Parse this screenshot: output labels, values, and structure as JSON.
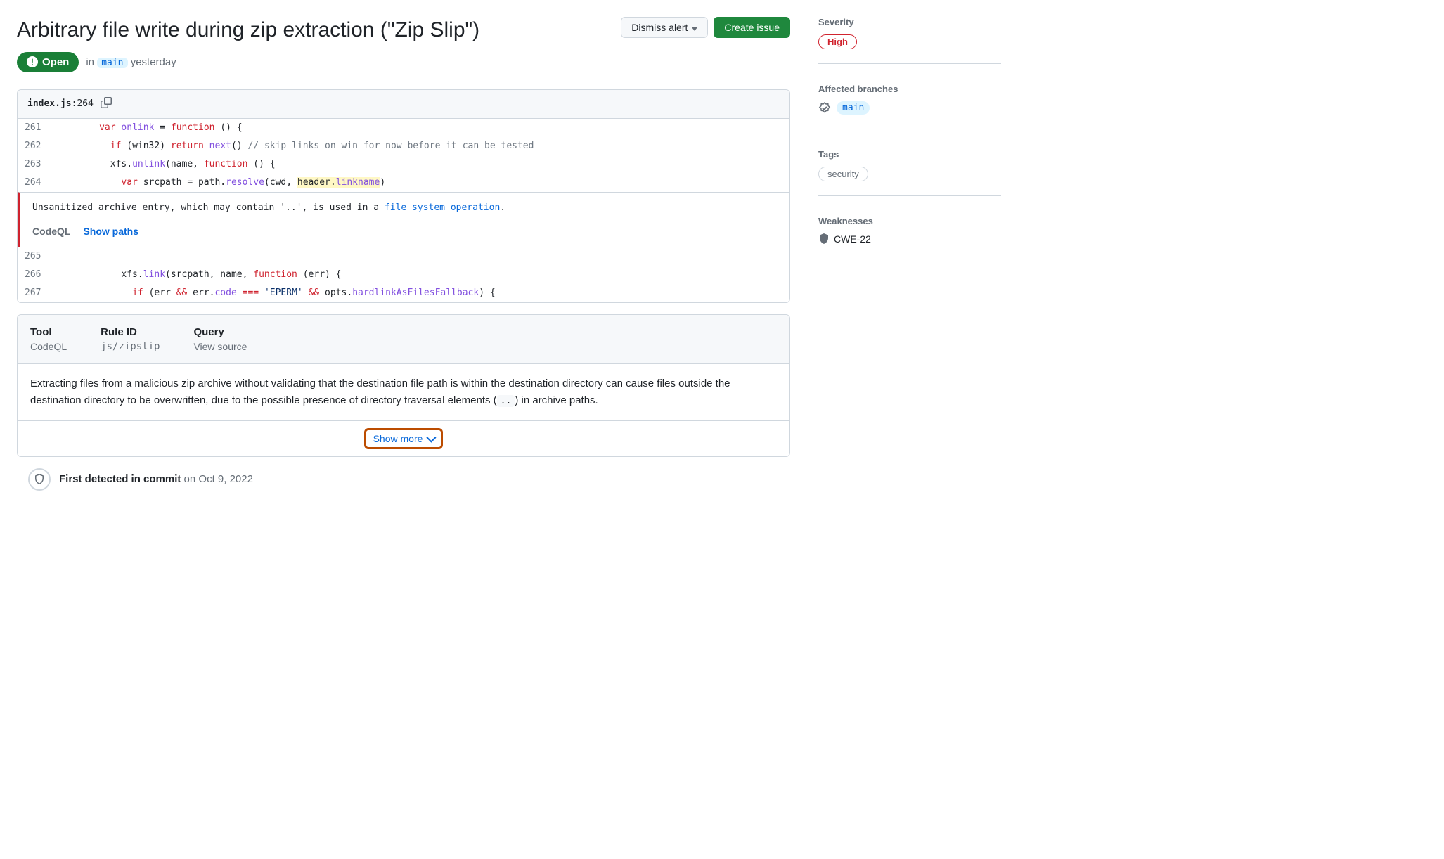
{
  "title": "Arbitrary file write during zip extraction (\"Zip Slip\")",
  "actions": {
    "dismiss": "Dismiss alert",
    "create_issue": "Create issue"
  },
  "status": {
    "state": "Open",
    "in_text": "in",
    "branch": "main",
    "time": "yesterday"
  },
  "code": {
    "filename": "index.js",
    "line": "264",
    "lines": [
      {
        "num": "261",
        "tokens": [
          {
            "t": "        ",
            "c": ""
          },
          {
            "t": "var",
            "c": "kw"
          },
          {
            "t": " ",
            "c": ""
          },
          {
            "t": "onlink",
            "c": "fn"
          },
          {
            "t": " = ",
            "c": ""
          },
          {
            "t": "function",
            "c": "kw"
          },
          {
            "t": " () {",
            "c": ""
          }
        ]
      },
      {
        "num": "262",
        "tokens": [
          {
            "t": "          ",
            "c": ""
          },
          {
            "t": "if",
            "c": "kw"
          },
          {
            "t": " (win32) ",
            "c": ""
          },
          {
            "t": "return",
            "c": "kw"
          },
          {
            "t": " ",
            "c": ""
          },
          {
            "t": "next",
            "c": "fn"
          },
          {
            "t": "() ",
            "c": ""
          },
          {
            "t": "// skip links on win for now before it can be tested",
            "c": "cm"
          }
        ]
      },
      {
        "num": "263",
        "tokens": [
          {
            "t": "          xfs.",
            "c": ""
          },
          {
            "t": "unlink",
            "c": "fn"
          },
          {
            "t": "(name, ",
            "c": ""
          },
          {
            "t": "function",
            "c": "kw"
          },
          {
            "t": " () {",
            "c": ""
          }
        ]
      },
      {
        "num": "264",
        "tokens": [
          {
            "t": "            ",
            "c": ""
          },
          {
            "t": "var",
            "c": "kw"
          },
          {
            "t": " srcpath = path.",
            "c": ""
          },
          {
            "t": "resolve",
            "c": "fn"
          },
          {
            "t": "(cwd, ",
            "c": ""
          },
          {
            "t": "header.",
            "c": "hl"
          },
          {
            "t": "linkname",
            "c": "hl fn"
          },
          {
            "t": ")",
            "c": ""
          }
        ]
      }
    ],
    "alert": {
      "msg_pre": "Unsanitized archive entry, which may contain '..', is used in a ",
      "msg_link": "file system operation",
      "msg_post": ".",
      "tool": "CodeQL",
      "show_paths": "Show paths"
    },
    "lines_after": [
      {
        "num": "265",
        "tokens": [
          {
            "t": "",
            "c": ""
          }
        ]
      },
      {
        "num": "266",
        "tokens": [
          {
            "t": "            xfs.",
            "c": ""
          },
          {
            "t": "link",
            "c": "fn"
          },
          {
            "t": "(srcpath, name, ",
            "c": ""
          },
          {
            "t": "function",
            "c": "kw"
          },
          {
            "t": " (err) {",
            "c": ""
          }
        ]
      },
      {
        "num": "267",
        "tokens": [
          {
            "t": "              ",
            "c": ""
          },
          {
            "t": "if",
            "c": "kw"
          },
          {
            "t": " (err ",
            "c": ""
          },
          {
            "t": "&&",
            "c": "kw"
          },
          {
            "t": " err.",
            "c": ""
          },
          {
            "t": "code",
            "c": "fn"
          },
          {
            "t": " ",
            "c": ""
          },
          {
            "t": "===",
            "c": "kw"
          },
          {
            "t": " ",
            "c": ""
          },
          {
            "t": "'EPERM'",
            "c": "st"
          },
          {
            "t": " ",
            "c": ""
          },
          {
            "t": "&&",
            "c": "kw"
          },
          {
            "t": " opts.",
            "c": ""
          },
          {
            "t": "hardlinkAsFilesFallback",
            "c": "fn"
          },
          {
            "t": ") {",
            "c": ""
          }
        ]
      }
    ]
  },
  "meta": {
    "cols": [
      {
        "label": "Tool",
        "value": "CodeQL",
        "mono": false
      },
      {
        "label": "Rule ID",
        "value": "js/zipslip",
        "mono": true
      },
      {
        "label": "Query",
        "value": "View source",
        "mono": false
      }
    ],
    "description_pre": "Extracting files from a malicious zip archive without validating that the destination file path is within the destination directory can cause files outside the destination directory to be overwritten, due to the possible presence of directory traversal elements (",
    "description_code": "..",
    "description_post": ") in archive paths.",
    "show_more": "Show more"
  },
  "timeline": {
    "label": "First detected in commit",
    "date": "on Oct 9, 2022"
  },
  "sidebar": {
    "severity": {
      "label": "Severity",
      "value": "High"
    },
    "branches": {
      "label": "Affected branches",
      "items": [
        "main"
      ]
    },
    "tags": {
      "label": "Tags",
      "items": [
        "security"
      ]
    },
    "weaknesses": {
      "label": "Weaknesses",
      "items": [
        "CWE-22"
      ]
    }
  }
}
